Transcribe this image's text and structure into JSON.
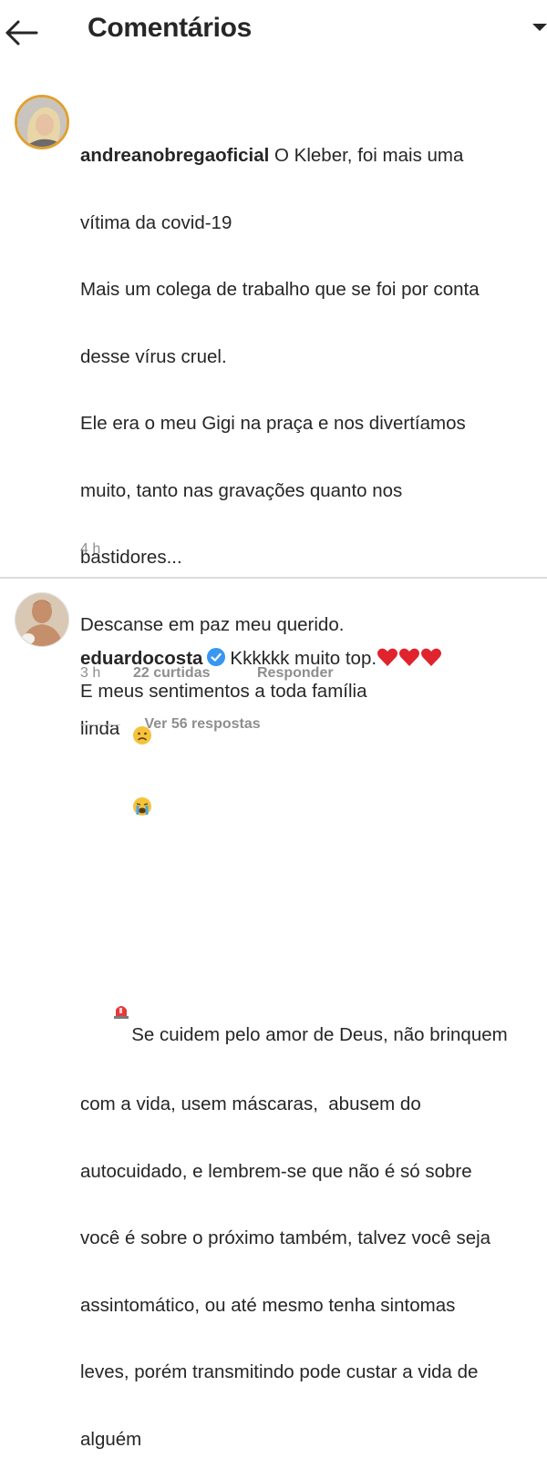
{
  "header": {
    "title": "Comentários"
  },
  "comments": [
    {
      "username": "andreanobregaoficial",
      "lines": [
        " O Kleber, foi mais uma",
        "vítima da covid-19",
        "Mais um colega de trabalho que se foi por conta",
        "desse vírus cruel.",
        "Ele era o meu Gigi na praça e nos divertíamos",
        "muito, tanto nas gravações quanto nos",
        "bastidores...",
        "Descanse em paz meu querido.",
        "E meus sentimentos a toda família",
        "",
        "Se cuidem pelo amor de Deus, não brinquem",
        "com a vida, usem máscaras,  abusem do",
        "autocuidado, e lembrem-se que não é só sobre",
        "você é sobre o próximo também, talvez você seja",
        "assintomático, ou até mesmo tenha sintomas",
        "leves, porém transmitindo pode custar a vida de",
        "alguém"
      ],
      "time": "4 h"
    },
    {
      "username": "eduardocosta",
      "text": "Kkkkkk muito top.",
      "line2": "linda",
      "time": "3 h",
      "likes": "22 curtidas",
      "reply": "Responder",
      "replies_link": "Ver 56 respostas"
    }
  ],
  "colors": {
    "text": "#262626",
    "muted": "#8e8e8e",
    "verified": "#3897f0",
    "heart": "#e0242e"
  }
}
